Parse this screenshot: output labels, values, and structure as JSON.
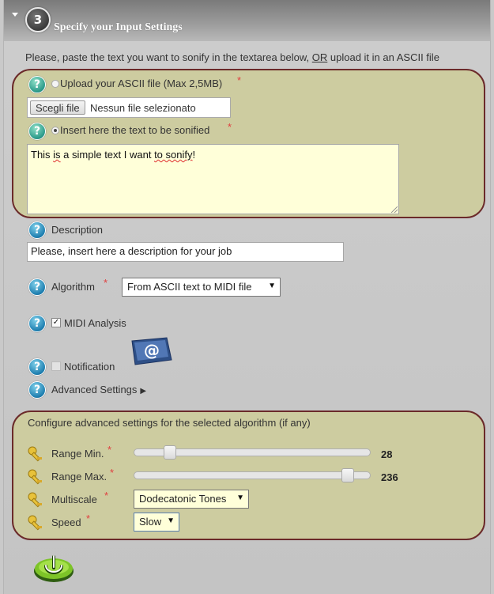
{
  "header": {
    "step": "3",
    "title": "Specify your Input Settings"
  },
  "intro": {
    "text_before": "Please, paste the text you want to sonify in the textarea below, ",
    "or_text": "OR",
    "text_after": " upload it in an ASCII file"
  },
  "upload": {
    "radio_label": "Upload your ASCII file (Max 2,5MB)",
    "required": "*",
    "button_label": "Scegli file",
    "file_status": "Nessun file selezionato"
  },
  "insert": {
    "radio_label": "Insert here the text to be sonified",
    "required": "*",
    "textarea_value_parts": [
      "This ",
      "is",
      " a simple text I want ",
      "to sonify",
      "!"
    ]
  },
  "description": {
    "label": "Description",
    "value": "Please, insert here a description for your job"
  },
  "algorithm": {
    "label": "Algorithm",
    "required": "*",
    "selected": "From ASCII text to MIDI file"
  },
  "midi_analysis": {
    "label": "MIDI Analysis",
    "checked": true
  },
  "notification": {
    "label": "Notification",
    "checked": false
  },
  "advanced": {
    "label": "Advanced Settings"
  },
  "advanced_box": {
    "title": "Configure advanced settings for the selected algorithm (if any)",
    "range_min": {
      "label": "Range Min.",
      "required": "*",
      "value": "28",
      "level": 0.13
    },
    "range_max": {
      "label": "Range Max.",
      "required": "*",
      "value": "236",
      "level": 0.93
    },
    "multiscale": {
      "label": "Multiscale",
      "required": "*",
      "selected": "Dodecatonic Tones"
    },
    "speed": {
      "label": "Speed",
      "required": "*",
      "selected": "Slow"
    }
  },
  "colors": {
    "box_fill": "#cdcca0",
    "box_border": "#6b2a2a",
    "required": "#e04040",
    "help_blue": "#1f7fb0",
    "help_teal": "#2c9a8a",
    "textarea_bg": "#ffffd9"
  },
  "icons": [
    "collapse-arrow-icon",
    "step-number-icon",
    "help-icon",
    "email-at-icon",
    "key-icon",
    "power-icon"
  ]
}
